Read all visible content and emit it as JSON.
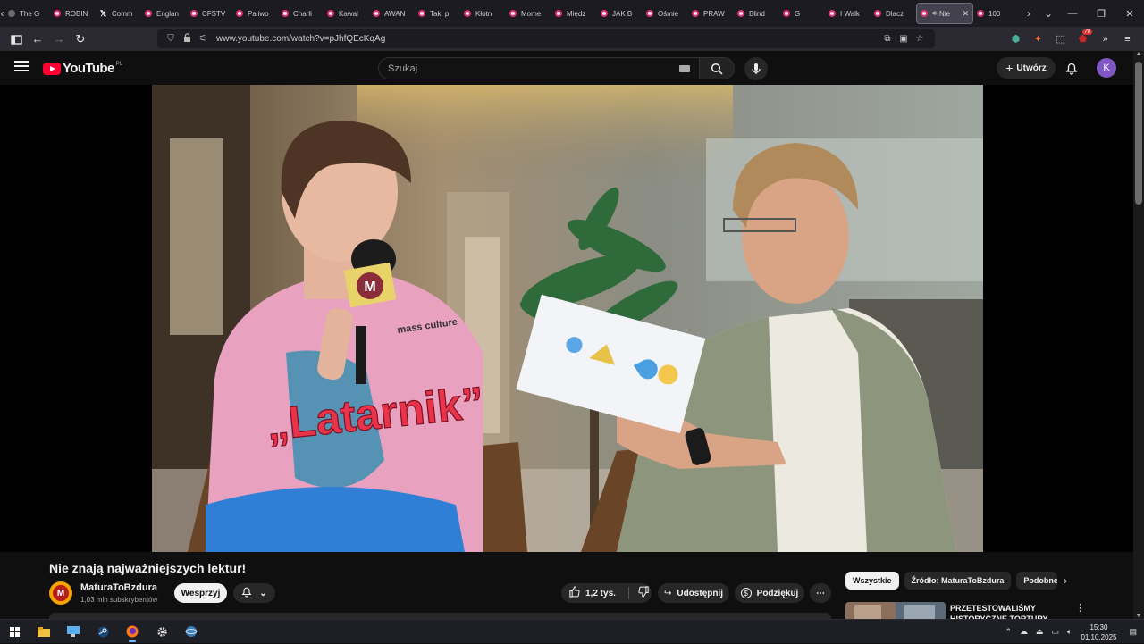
{
  "browser": {
    "tabs": [
      {
        "label": "The G",
        "icon": "plain"
      },
      {
        "label": "ROBIN",
        "icon": "youtube"
      },
      {
        "label": "Comm",
        "icon": "x"
      },
      {
        "label": "Englan",
        "icon": "youtube"
      },
      {
        "label": "CFSTV",
        "icon": "youtube"
      },
      {
        "label": "Paliwo",
        "icon": "youtube"
      },
      {
        "label": "Charli",
        "icon": "youtube"
      },
      {
        "label": "Kawal",
        "icon": "youtube"
      },
      {
        "label": "AWAN",
        "icon": "youtube"
      },
      {
        "label": "Tak, p",
        "icon": "youtube"
      },
      {
        "label": "Kłótn",
        "icon": "youtube"
      },
      {
        "label": "Mome",
        "icon": "youtube"
      },
      {
        "label": "Międz",
        "icon": "youtube"
      },
      {
        "label": "JAK B",
        "icon": "youtube"
      },
      {
        "label": "Ośmie",
        "icon": "youtube"
      },
      {
        "label": "PRAW",
        "icon": "youtube"
      },
      {
        "label": "Blind",
        "icon": "youtube"
      },
      {
        "label": "G",
        "icon": "youtube"
      },
      {
        "label": "I Walk",
        "icon": "youtube"
      },
      {
        "label": "Dlacz",
        "icon": "youtube"
      }
    ],
    "active_tab": {
      "label": "Nie",
      "close": "✕"
    },
    "after_tabs": [
      {
        "label": "100",
        "icon": "youtube"
      }
    ],
    "url": "www.youtube.com/watch?v=pJhfQEcKqAg",
    "extensions_badge": "70"
  },
  "youtube": {
    "logo_text": "YouTube",
    "country_code": "PL",
    "search_placeholder": "Szukaj",
    "create_label": "Utwórz",
    "avatar_letter": "K"
  },
  "video": {
    "title": "Nie znają najważniejszych lektur!",
    "overlay_text": "„Latarnik”",
    "mic_logo_letter": "M",
    "shirt_text": "mass culture",
    "emoji_card": [
      "fish",
      "sailboat",
      "pacman",
      "emoji-face"
    ]
  },
  "channel": {
    "name": "MaturaToBzdura",
    "subscribers": "1,03 mln subskrybentów",
    "avatar_letter": "M",
    "support_label": "Wesprzyj"
  },
  "actions": {
    "likes": "1,2 tys.",
    "share_label": "Udostępnij",
    "thanks_label": "Podziękuj",
    "more_label": "⋯"
  },
  "sidebar": {
    "chips": [
      "Wszystkie",
      "Źródło: MaturaToBzdura",
      "Podobne"
    ],
    "selected_chip": 0,
    "recommendation_title": "PRZETESTOWALIŚMY HISTORYCZNE TORTURY"
  },
  "taskbar": {
    "time": "15:30",
    "date": "01.10.2025"
  },
  "colors": {
    "yt_red": "#ff0033",
    "background": "#0f0f0f",
    "overlay_text": "#e8334a",
    "avatar_purple": "#7e57c2"
  }
}
